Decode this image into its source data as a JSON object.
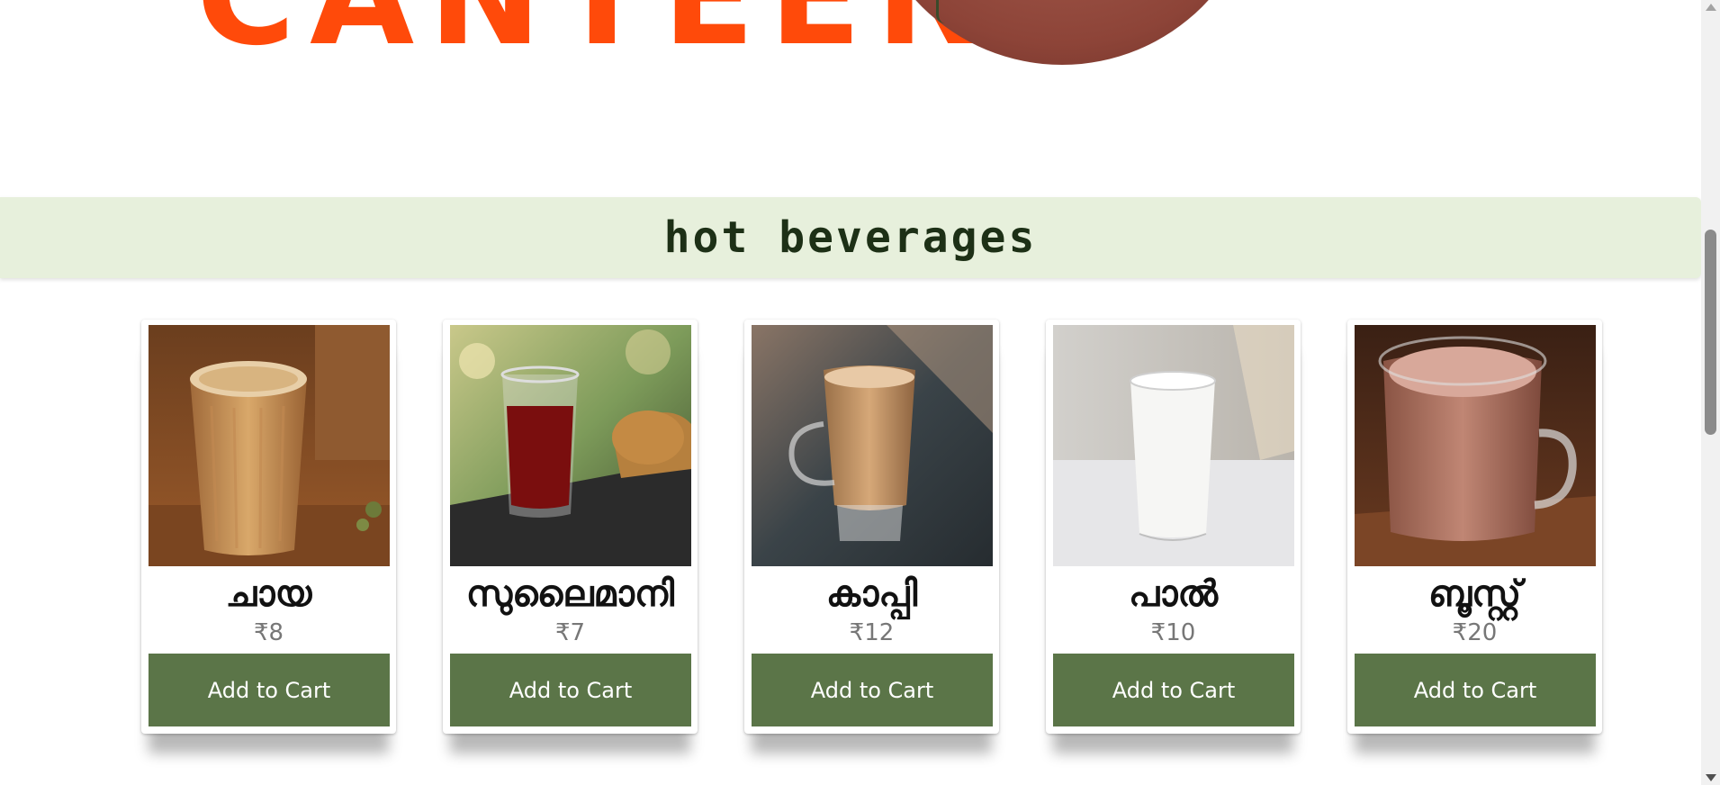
{
  "header": {
    "logo_text": "CANTEEN"
  },
  "section": {
    "title": "hot beverages"
  },
  "items": [
    {
      "name": "ചായ",
      "price": "₹8",
      "button_label": "Add to Cart",
      "image_icon": "tea-glass-photo"
    },
    {
      "name": "സുലൈമാനി",
      "price": "₹7",
      "button_label": "Add to Cart",
      "image_icon": "black-tea-glass-photo"
    },
    {
      "name": "കാപ്പി",
      "price": "₹12",
      "button_label": "Add to Cart",
      "image_icon": "coffee-glass-photo"
    },
    {
      "name": "പാൽ",
      "price": "₹10",
      "button_label": "Add to Cart",
      "image_icon": "milk-glass-photo"
    },
    {
      "name": "ബൂസ്റ്റ്",
      "price": "₹20",
      "button_label": "Add to Cart",
      "image_icon": "boost-mug-photo"
    }
  ],
  "colors": {
    "brand_orange": "#ff4a0a",
    "section_band": "#e7f0dc",
    "section_text": "#1d3016",
    "button_green": "#5b7548",
    "price_gray": "#777777"
  }
}
